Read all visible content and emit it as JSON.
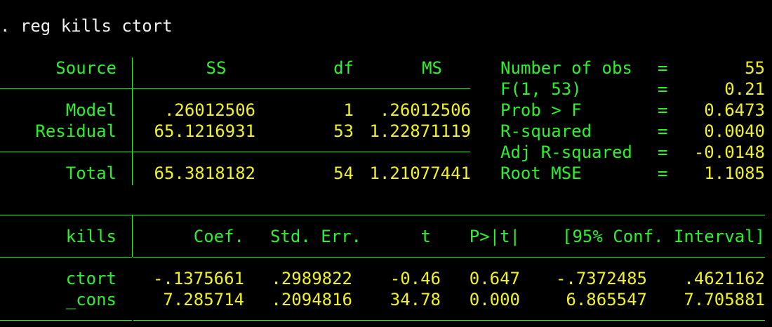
{
  "command": ". reg kills ctort",
  "anova": {
    "headers": {
      "source": "Source",
      "ss": "SS",
      "df": "df",
      "ms": "MS"
    },
    "rows": [
      {
        "source": "Model",
        "ss": ".26012506",
        "df": "1",
        "ms": ".26012506"
      },
      {
        "source": "Residual",
        "ss": "65.1216931",
        "df": "53",
        "ms": "1.22871119"
      },
      {
        "source": "Total",
        "ss": "65.3818182",
        "df": "54",
        "ms": "1.21077441"
      }
    ]
  },
  "stats": [
    {
      "label": "Number of obs",
      "eq": "=",
      "value": "55"
    },
    {
      "label": "F(1, 53)",
      "eq": "=",
      "value": "0.21"
    },
    {
      "label": "Prob > F",
      "eq": "=",
      "value": "0.6473"
    },
    {
      "label": "R-squared",
      "eq": "=",
      "value": "0.0040"
    },
    {
      "label": "Adj R-squared",
      "eq": "=",
      "value": "-0.0148"
    },
    {
      "label": "Root MSE",
      "eq": "=",
      "value": "1.1085"
    }
  ],
  "coef": {
    "headers": {
      "var": "kills",
      "coef": "Coef.",
      "se": "Std. Err.",
      "t": "t",
      "p": "P>|t|",
      "ci": "[95% Conf. Interval]"
    },
    "rows": [
      {
        "var": "ctort",
        "coef": "-.1375661",
        "se": ".2989822",
        "t": "-0.46",
        "p": "0.647",
        "lo": "-.7372485",
        "hi": ".4621162"
      },
      {
        "var": "_cons",
        "coef": "7.285714",
        "se": ".2094816",
        "t": "34.78",
        "p": "0.000",
        "lo": "6.865547",
        "hi": "7.705881"
      }
    ]
  },
  "colors": {
    "background": "#000000",
    "label": "#2cf22c",
    "value": "#f2f21f",
    "command": "#f0f0f0"
  }
}
